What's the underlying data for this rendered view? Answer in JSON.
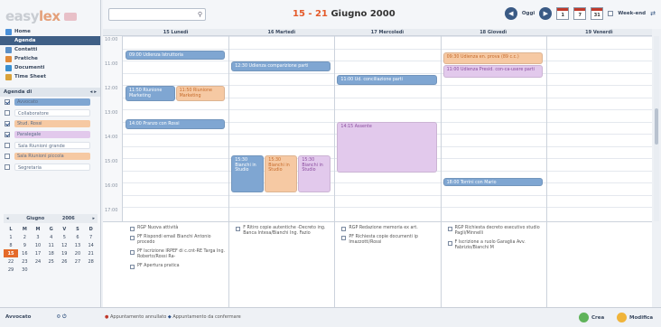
{
  "app": {
    "logo_text": "easy",
    "logo_accent": "lex"
  },
  "nav": [
    {
      "label": "Home",
      "icon": "home-icon"
    },
    {
      "label": "Agenda",
      "icon": "agenda-icon",
      "active": true
    },
    {
      "label": "Contatti",
      "icon": "contacts-icon"
    },
    {
      "label": "Pratiche",
      "icon": "folder-icon"
    },
    {
      "label": "Documenti",
      "icon": "document-icon"
    },
    {
      "label": "Time Sheet",
      "icon": "timesheet-icon"
    }
  ],
  "agenda_panel": {
    "title": "Agenda di",
    "calendars": [
      {
        "label": "Avvocato",
        "checked": true,
        "color": "#7fa6d2"
      },
      {
        "label": "Collaboratore",
        "checked": false,
        "color": "#ffffff"
      },
      {
        "label": "Stud. Rossi",
        "checked": true,
        "color": "#f6c9a3"
      },
      {
        "label": "Paralegale",
        "checked": true,
        "color": "#e2c9ec"
      },
      {
        "label": "Sala Riunioni grande",
        "checked": false,
        "color": "#ffffff"
      },
      {
        "label": "Sala Riunioni piccola",
        "checked": false,
        "color": "#f6c9a3"
      },
      {
        "label": "Segretaria",
        "checked": false,
        "color": "#ffffff"
      }
    ]
  },
  "mini_calendar": {
    "month": "Giugno",
    "year": "2006",
    "weekdays": [
      "L",
      "M",
      "M",
      "G",
      "V",
      "S",
      "D"
    ],
    "weeks": [
      [
        "1",
        "2",
        "3",
        "4",
        "5",
        "6",
        "7"
      ],
      [
        "8",
        "9",
        "10",
        "11",
        "12",
        "13",
        "14"
      ],
      [
        "15",
        "16",
        "17",
        "18",
        "19",
        "20",
        "21"
      ],
      [
        "22",
        "23",
        "24",
        "25",
        "26",
        "27",
        "28"
      ],
      [
        "29",
        "30",
        "",
        "",
        "",
        "",
        ""
      ]
    ],
    "today": "15"
  },
  "header": {
    "search_placeholder": "",
    "date_range": "15 - 21",
    "date_month": "Giugno 2000",
    "today_label": "Oggi",
    "view_day": "1",
    "view_week": "7",
    "view_month": "31",
    "weekend_label": "Week-end"
  },
  "days": [
    "15 Lunedì",
    "16 Martedì",
    "17 Mercoledì",
    "18 Giovedì",
    "19 Venerdì"
  ],
  "hours": [
    "10:00",
    "",
    "11:00",
    "",
    "12:00",
    "",
    "13:00",
    "",
    "14:00",
    "",
    "15:00",
    "",
    "16:00",
    "",
    "17:00"
  ],
  "events": [
    {
      "day": 0,
      "start": 1.2,
      "end": 1.9,
      "label": "09:00 Udienza Istruttoria",
      "cls": "blue",
      "col": 0,
      "cols": 1
    },
    {
      "day": 1,
      "start": 2.1,
      "end": 2.9,
      "label": "12:30 Udienza comparizione parti",
      "cls": "blue",
      "col": 0,
      "cols": 1
    },
    {
      "day": 0,
      "start": 4.1,
      "end": 5.3,
      "label": "11:50 Riunione Marketing",
      "cls": "blue",
      "col": 0,
      "cols": 2
    },
    {
      "day": 0,
      "start": 4.1,
      "end": 5.3,
      "label": "11:50 Riunione Marketing",
      "cls": "orange",
      "col": 1,
      "cols": 2
    },
    {
      "day": 0,
      "start": 6.8,
      "end": 7.6,
      "label": "14:00 Pranzo con Rossi",
      "cls": "blue",
      "col": 0,
      "cols": 1
    },
    {
      "day": 2,
      "start": 3.2,
      "end": 4.0,
      "label": "11:00 Ud. conciliazione parti",
      "cls": "blue",
      "col": 0,
      "cols": 1
    },
    {
      "day": 2,
      "start": 7.0,
      "end": 11.2,
      "label": "14:15 Assente",
      "cls": "pink",
      "col": 0,
      "cols": 1
    },
    {
      "day": 3,
      "start": 1.3,
      "end": 2.3,
      "label": "09:30 Udienza en. prova (89 c.c.)",
      "cls": "orange",
      "col": 0,
      "cols": 1
    },
    {
      "day": 3,
      "start": 2.4,
      "end": 3.4,
      "label": "11:00 Udienza Presid. con-ca-usere parti",
      "cls": "pink",
      "col": 0,
      "cols": 1
    },
    {
      "day": 1,
      "start": 9.8,
      "end": 12.8,
      "label": "15:30 Bianchi in Studio",
      "cls": "blue",
      "col": 0,
      "cols": 3
    },
    {
      "day": 1,
      "start": 9.8,
      "end": 12.8,
      "label": "15:30 Bianchi in Studio",
      "cls": "orange",
      "col": 1,
      "cols": 3
    },
    {
      "day": 1,
      "start": 9.8,
      "end": 12.8,
      "label": "15:30 Bianchi in Studio",
      "cls": "pink",
      "col": 2,
      "cols": 3
    },
    {
      "day": 3,
      "start": 11.6,
      "end": 12.3,
      "label": "18:00 Torrini con Mario",
      "cls": "blue",
      "col": 0,
      "cols": 1
    }
  ],
  "tasks": [
    [
      "RGP Nuova attività",
      "PF Rispondi email Bianchi Antonio procedo",
      "PF Iscrizione IRPEF di c.cnt-RE Targa Ing. Roberto/Rossi Ra-",
      "PF Apertura pratica"
    ],
    [
      "F Ritiro copie autentiche -Decreto ing. Banca Intesa/Bianchi Ing. Fazio"
    ],
    [
      "RGP Redazione memoria ex art.",
      "PF Richiesta copie documenti ip Imazzotti/Rossi"
    ],
    [
      "RGP Richiesta decreto esecutivo studio Pagli/Minnelli",
      "F Iscrizione a ruolo Garaglia Avv. Fabrizio/Bianchi M"
    ],
    []
  ],
  "status": {
    "user": "Avvocato",
    "legend_red": "Appuntamento annullato",
    "legend_blue": "Appuntamento da confermare",
    "new_label": "Crea",
    "edit_label": "Modifica"
  },
  "colors": {
    "accent": "#e45a2a",
    "nav_active": "#3f5f86",
    "blue_event": "#7fa6d2",
    "orange_event": "#f6c9a3",
    "pink_event": "#e2c9ec"
  }
}
